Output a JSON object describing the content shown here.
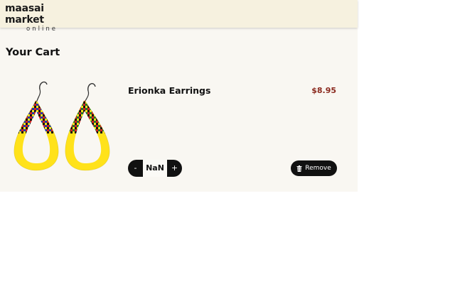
{
  "brand": {
    "name": "maasai market",
    "tagline": "online"
  },
  "page": {
    "title": "Your Cart"
  },
  "cart": {
    "items": [
      {
        "name": "Erionka Earrings",
        "price": "$8.95",
        "quantity": "NaN",
        "image_icon": "beaded-earrings-image"
      }
    ]
  },
  "controls": {
    "decrement_label": "-",
    "increment_label": "+",
    "remove_label": "Remove",
    "remove_icon": "trash-icon"
  },
  "colors": {
    "header_bg": "#f6f1df",
    "page_bg": "#f9f7f2",
    "price": "#8b2a1f",
    "button_bg": "#111111",
    "bead_yellow": "#ffe21a"
  }
}
